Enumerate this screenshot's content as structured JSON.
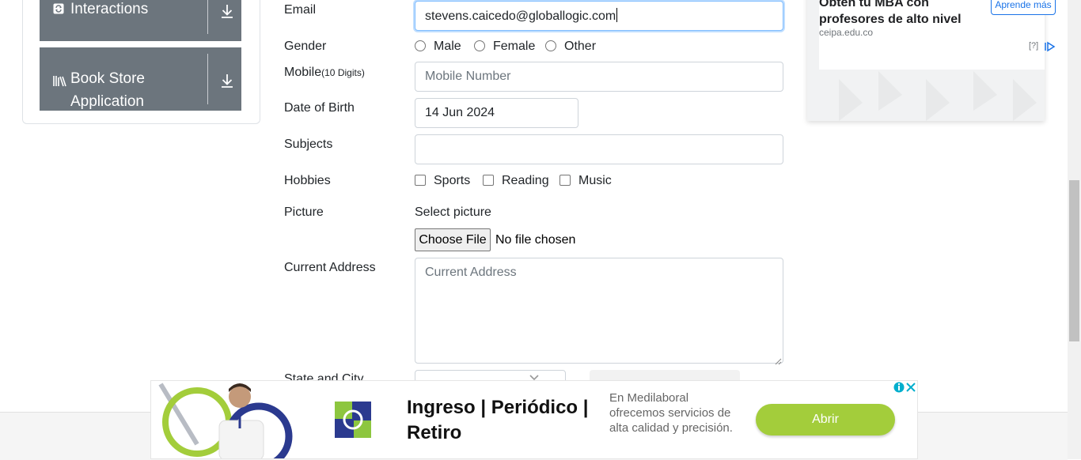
{
  "sidebar": {
    "groups": [
      {
        "label": "Interactions",
        "icon": "refresh-icon"
      },
      {
        "label_line1": "Book Store",
        "label_line2": "Application",
        "icon": "books-icon"
      }
    ]
  },
  "form": {
    "email": {
      "label": "Email",
      "value": "stevens.caicedo@globallogic.com"
    },
    "gender": {
      "label": "Gender",
      "options": [
        "Male",
        "Female",
        "Other"
      ]
    },
    "mobile": {
      "label": "Mobile",
      "hint": "(10 Digits)",
      "placeholder": "Mobile Number"
    },
    "dob": {
      "label": "Date of Birth",
      "value": "14 Jun 2024"
    },
    "subjects": {
      "label": "Subjects",
      "value": ""
    },
    "hobbies": {
      "label": "Hobbies",
      "options": [
        "Sports",
        "Reading",
        "Music"
      ]
    },
    "picture": {
      "label": "Picture",
      "caption": "Select picture",
      "button": "Choose File",
      "status": "No file chosen"
    },
    "address": {
      "label": "Current Address",
      "placeholder": "Current Address"
    },
    "state_city": {
      "label": "State and City"
    }
  },
  "ad_card": {
    "title_line1": "Obtén tu MBA con",
    "title_line2": "profesores de alto nivel",
    "domain": "ceipa.edu.co",
    "button": "Aprende más",
    "info": "[?]",
    "colors": {
      "accent": "#1a73e8"
    }
  },
  "bottom_ad": {
    "headline": "Ingreso | Periódico | Retiro",
    "description": "En Medilaboral ofrecemos servicios de alta calidad y precisión.",
    "button": "Abrir",
    "colors": {
      "button": "#a3cd3b",
      "logo_blue": "#2b3a8f",
      "logo_green": "#8dc63f"
    }
  },
  "colors": {
    "sidebar_group": "#6c757d",
    "focus_border": "#80bdff"
  }
}
